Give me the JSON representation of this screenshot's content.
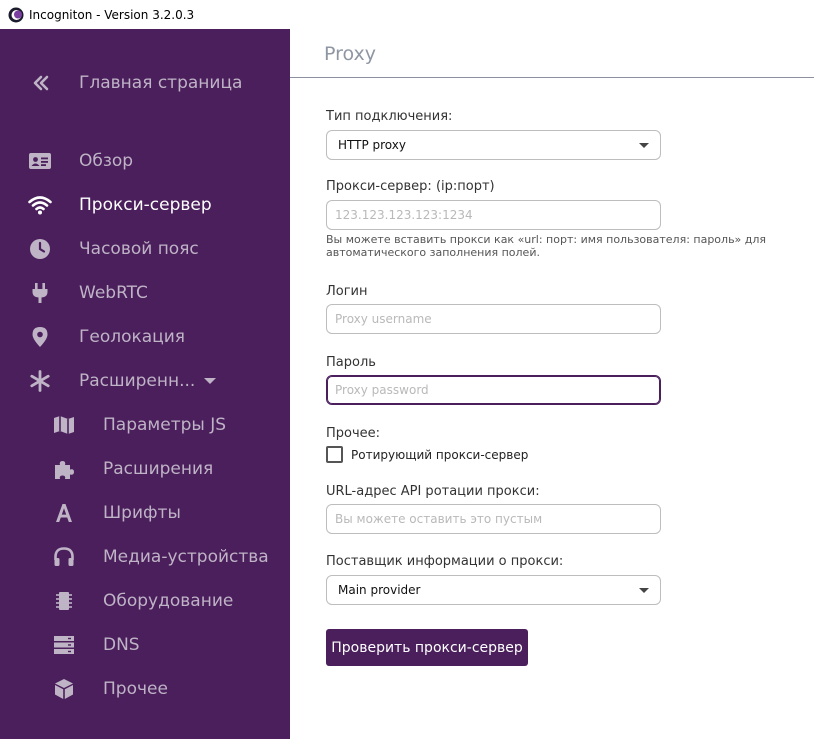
{
  "window": {
    "title": "Incogniton - Version 3.2.0.3",
    "icon": "incogniton-logo-icon"
  },
  "colors": {
    "sidebar_bg": "#4a1f5c",
    "accent": "#4a1f5c",
    "sidebar_text": "#bfb3c6",
    "sidebar_active_text": "#ffffff"
  },
  "sidebar": {
    "back": {
      "label": "Главная страница",
      "icon": "double-chevron-left-icon"
    },
    "items": [
      {
        "label": "Обзор",
        "icon": "id-card-icon"
      },
      {
        "label": "Прокси-сервер",
        "icon": "wifi-icon",
        "active": true
      },
      {
        "label": "Часовой пояс",
        "icon": "clock-icon"
      },
      {
        "label": "WebRTC",
        "icon": "plug-icon"
      },
      {
        "label": "Геолокация",
        "icon": "map-pin-icon"
      },
      {
        "label": "Расширенн...",
        "icon": "asterisk-icon",
        "expandable": true
      }
    ],
    "subitems": [
      {
        "label": "Параметры JS",
        "icon": "map-icon"
      },
      {
        "label": "Расширения",
        "icon": "puzzle-icon"
      },
      {
        "label": "Шрифты",
        "icon": "font-icon"
      },
      {
        "label": "Медиа-устройства",
        "icon": "headphones-icon"
      },
      {
        "label": "Оборудование",
        "icon": "chip-icon"
      },
      {
        "label": "DNS",
        "icon": "server-icon"
      },
      {
        "label": "Прочее",
        "icon": "cube-icon"
      }
    ]
  },
  "main": {
    "title": "Proxy",
    "connection_type": {
      "label": "Тип подключения:",
      "value": "HTTP proxy"
    },
    "proxy_server": {
      "label": "Прокси-сервер: (ip:порт)",
      "placeholder": "123.123.123.123:1234",
      "hint": "Вы можете вставить прокси как «url: порт: имя пользователя: пароль» для автоматического заполнения полей."
    },
    "login": {
      "label": "Логин",
      "placeholder": "Proxy username"
    },
    "password": {
      "label": "Пароль",
      "placeholder": "Proxy password"
    },
    "other": {
      "label": "Прочее:",
      "checkbox_label": "Ротирующий прокси-сервер"
    },
    "rotation_api": {
      "label": "URL-адрес API ротации прокси:",
      "placeholder": "Вы можете оставить это пустым"
    },
    "provider": {
      "label": "Поставщик информации о прокси:",
      "value": "Main provider"
    },
    "check_button": "Проверить прокси-сервер"
  }
}
